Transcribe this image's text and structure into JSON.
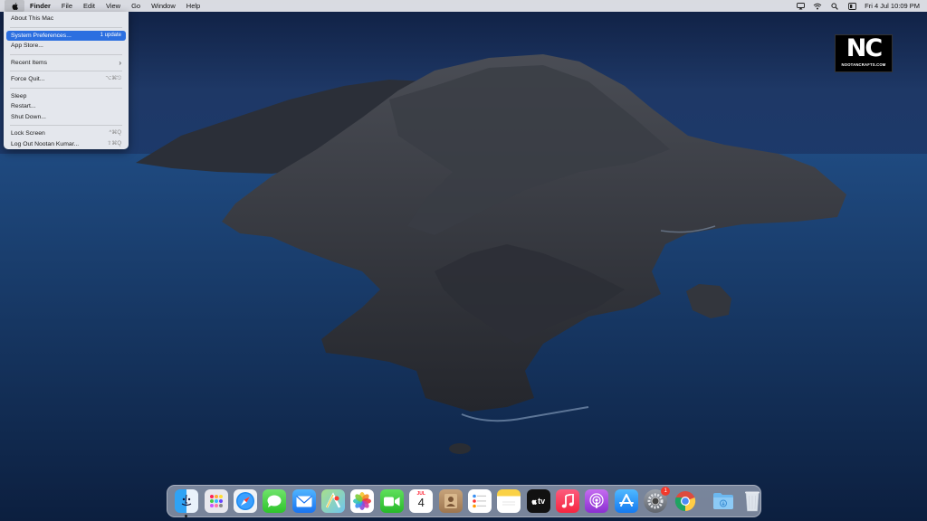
{
  "menubar": {
    "app_name": "Finder",
    "menus": [
      "File",
      "Edit",
      "View",
      "Go",
      "Window",
      "Help"
    ],
    "datetime": "Fri 4 Jul  10:09 PM"
  },
  "apple_menu": {
    "items": [
      {
        "label": "About This Mac"
      },
      {
        "label": "System Preferences...",
        "badge": "1 update"
      },
      {
        "label": "App Store..."
      },
      {
        "label": "Recent Items"
      },
      {
        "label": "Force Quit...",
        "shortcut": "⌥⌘⎋"
      },
      {
        "label": "Sleep"
      },
      {
        "label": "Restart..."
      },
      {
        "label": "Shut Down..."
      },
      {
        "label": "Lock Screen",
        "shortcut": "^⌘Q"
      },
      {
        "label": "Log Out Nootan Kumar...",
        "shortcut": "⇧⌘Q"
      }
    ]
  },
  "logo": {
    "initials": "NC",
    "site": "NOOTANCRAFTS.COM"
  },
  "dock": {
    "calendar_month": "JUL",
    "calendar_day": "4",
    "tv_label": "tv",
    "settings_badge": "1",
    "icons": [
      "finder-icon",
      "launchpad-icon",
      "safari-icon",
      "messages-icon",
      "mail-icon",
      "maps-icon",
      "photos-icon",
      "facetime-icon",
      "calendar-icon",
      "contacts-icon",
      "reminders-icon",
      "notes-icon",
      "apple-tv-icon",
      "music-icon",
      "podcasts-icon",
      "app-store-icon",
      "system-preferences-icon",
      "chrome-icon",
      "downloads-folder-icon",
      "trash-icon"
    ]
  },
  "colors": {
    "menu_highlight": "#2c6fe0",
    "wallpaper_sky": "#1a3060",
    "wallpaper_sea": "#14305c"
  }
}
